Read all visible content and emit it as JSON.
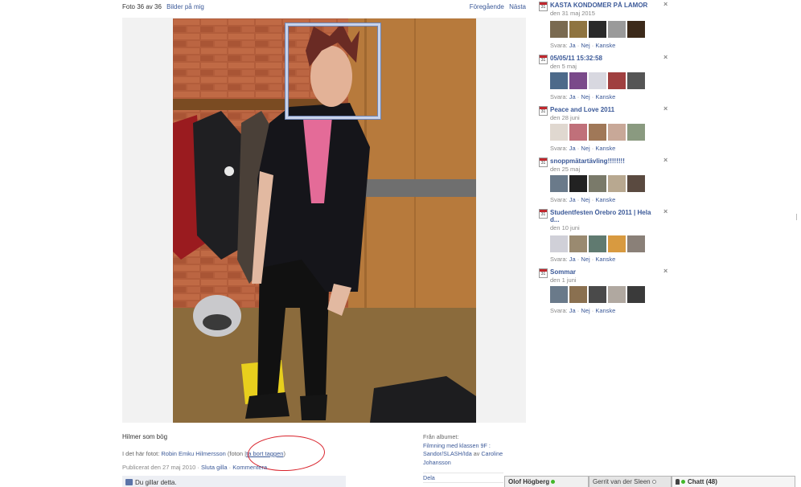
{
  "viewer": {
    "photo_counter": "Foto 36 av 36",
    "album_link": "Bilder på mig",
    "prev_label": "Föregående",
    "next_label": "Nästa"
  },
  "photo": {
    "caption": "Hilmer som bög",
    "in_photo_label": "I det här fotot:",
    "tagged_person": "Robin Emku Hilmersson",
    "tag_meta_prefix": "(foton |",
    "remove_tag": "ta bort taggen",
    "tag_meta_suffix": ")",
    "published": "Publicerat den 27 maj 2010",
    "sep1": "·",
    "stop_like": "Sluta gilla",
    "sep2": "·",
    "comment": "Kommentera",
    "like_text": "Du gillar detta.",
    "annotation_color": "#d9232c"
  },
  "album": {
    "from_label": "Från albumet:",
    "album_name": "Filmning med klassen 9F : Sandor/SLASH/Ida",
    "by_label": "av",
    "owner": "Caroline Johansson"
  },
  "share": {
    "share_label": "Dela"
  },
  "events": [
    {
      "title": "KASTA KONDOMER PÅ LAMOR",
      "date": "den 31 maj 2015",
      "rsvp_label": "Svara:",
      "yes": "Ja",
      "no": "Nej",
      "maybe": "Kanske",
      "cal_day": "31"
    },
    {
      "title": "05/05/11 15:32:58",
      "date": "den 5 maj",
      "rsvp_label": "Svara:",
      "yes": "Ja",
      "no": "Nej",
      "maybe": "Kanske",
      "cal_day": "31"
    },
    {
      "title": "Peace and Love 2011",
      "date": "den 28 juni",
      "rsvp_label": "Svara:",
      "yes": "Ja",
      "no": "Nej",
      "maybe": "Kanske",
      "cal_day": "31"
    },
    {
      "title": "snoppmätartävling!!!!!!!!",
      "date": "den 25 maj",
      "rsvp_label": "Svara:",
      "yes": "Ja",
      "no": "Nej",
      "maybe": "Kanske",
      "cal_day": "31"
    },
    {
      "title": "Studentfesten Örebro 2011 | Hela d...",
      "date": "den 10 juni",
      "rsvp_label": "Svara:",
      "yes": "Ja",
      "no": "Nej",
      "maybe": "Kanske",
      "cal_day": "31"
    },
    {
      "title": "Sommar",
      "date": "den 1 juni",
      "rsvp_label": "Svara:",
      "yes": "Ja",
      "no": "Nej",
      "maybe": "Kanske",
      "cal_day": "31"
    }
  ],
  "chat": {
    "tab1_name": "Olof Högberg",
    "tab2_name": "Gerrit van der Sleen",
    "chat_label": "Chatt",
    "online_count": "(48)"
  },
  "colors": {
    "link": "#3b5998",
    "online": "#42b72a",
    "tag_box": "#c9d3ea"
  }
}
